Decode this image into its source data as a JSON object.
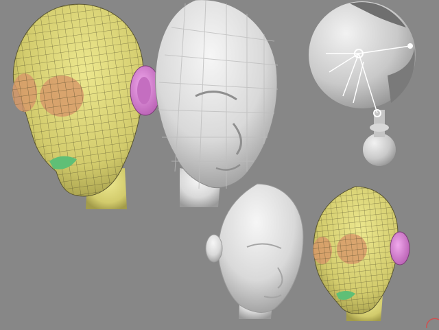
{
  "viewport": {
    "background": "#878787"
  },
  "models": [
    {
      "id": "large-wireframe-head",
      "style": "wireframe-colored",
      "skin": "#dcd678",
      "eye": "#d79a6a",
      "ear": "#d77fd2",
      "mouth": "#5fbf76"
    },
    {
      "id": "large-faceted-head",
      "style": "flat-shaded",
      "skin": "#e3e3e3"
    },
    {
      "id": "shaded-sphere-rig",
      "style": "smooth-shaded",
      "skin": "#d4d4d4",
      "joint_color": "#ffffff"
    },
    {
      "id": "small-smooth-head",
      "style": "smooth-shaded",
      "skin": "#e6e6e6"
    },
    {
      "id": "small-wireframe-head",
      "style": "wireframe-colored",
      "skin": "#dcd678",
      "eye": "#d79a6a",
      "ear": "#d77fd2",
      "mouth": "#5fbf76"
    }
  ],
  "corner_marker_color": "#d05050"
}
